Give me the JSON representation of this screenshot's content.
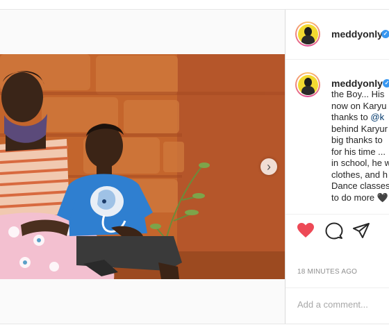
{
  "post": {
    "username": "meddyonly",
    "verified": true,
    "caption_lines": [
      {
        "parts": [
          {
            "text": "the Boy... His"
          }
        ]
      },
      {
        "parts": [
          {
            "text": "now on Karyu"
          }
        ]
      },
      {
        "parts": [
          {
            "text": "thanks to "
          },
          {
            "text": "@k",
            "mention": true
          }
        ]
      },
      {
        "parts": [
          {
            "text": "behind Karyur"
          }
        ]
      },
      {
        "parts": [
          {
            "text": "big thanks to"
          }
        ]
      },
      {
        "parts": [
          {
            "text": "for his time ..."
          }
        ]
      },
      {
        "parts": [
          {
            "text": "in school, he w"
          }
        ]
      },
      {
        "parts": [
          {
            "text": "clothes, and h"
          }
        ]
      },
      {
        "parts": [
          {
            "text": "Dance classes"
          }
        ]
      },
      {
        "parts": [
          {
            "text": "to do more 🖤"
          }
        ]
      }
    ],
    "timestamp": "18 MINUTES AGO",
    "comment_placeholder": "Add a comment..."
  },
  "colors": {
    "accent_like": "#ed4956",
    "verified_badge": "#3897f0",
    "mention": "#00376b",
    "muted_text": "#8e8e8e"
  },
  "icons": {
    "like": "heart-icon",
    "comment": "comment-icon",
    "share": "share-icon",
    "next": "chevron-right-icon",
    "verified": "verified-badge-icon"
  }
}
